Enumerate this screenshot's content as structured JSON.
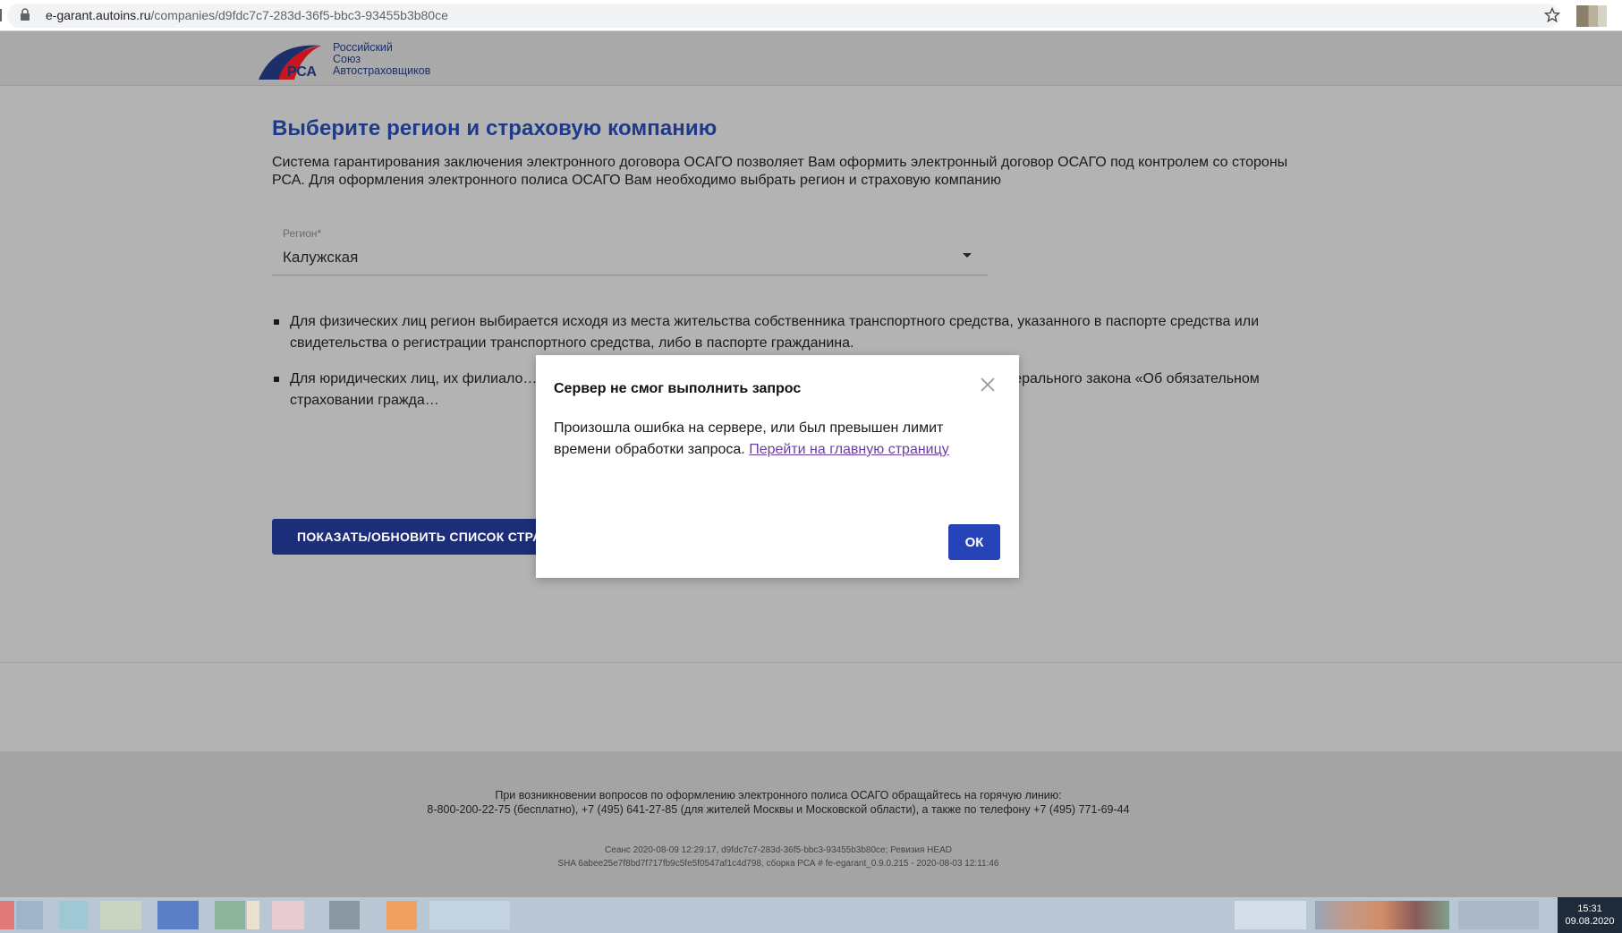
{
  "browser": {
    "url_host": "e-garant.autoins.ru",
    "url_path": "/companies/d9fdc7c7-283d-36f5-bbc3-93455b3b80ce"
  },
  "header": {
    "logo_abbr": "РСА",
    "logo_line1": "Российский",
    "logo_line2": "Союз",
    "logo_line3": "Автостраховщиков"
  },
  "main": {
    "title": "Выберите регион и страховую компанию",
    "intro": "Система гарантирования заключения электронного договора ОСАГО позволяет Вам оформить электронный договор ОСАГО под контролем со стороны РСА. Для оформления электронного полиса ОСАГО Вам необходимо выбрать регион и страховую компанию",
    "region_label": "Регион*",
    "region_value": "Калужская",
    "notes": [
      "Для физических лиц регион выбирается исходя из места жительства собственника транспортного средства, указанного в паспорте средства или свидетельства о регистрации транспортного средства, либо в паспорте гражданина.",
      "Для юридических лиц, их филиало… , его филиала или представительства, указанного в у… 2 статьи 9 Федерального закона «Об обязательном страховании гражда…"
    ],
    "show_button": "ПОКАЗАТЬ/ОБНОВИТЬ СПИСОК СТРАХ"
  },
  "footer": {
    "hotline_1": "При возникновении вопросов по оформлению электронного полиса ОСАГО обращайтесь на горячую линию:",
    "hotline_2": "8-800-200-22-75 (бесплатно), +7 (495) 641-27-85 (для жителей Москвы и Московской области), а также по телефону +7 (495) 771-69-44",
    "session": "Сеанс 2020-08-09 12:29:17, d9fdc7c7-283d-36f5-bbc3-93455b3b80ce; Ревизия HEAD",
    "build": "SHA 6abee25e7f8bd7f717fb9c5fe5f0547af1c4d798, сборка РСА # fe-egarant_0.9.0.215 - 2020-08-03 12:11:46"
  },
  "taskbar": {
    "time": "15:31",
    "date": "09.08.2020"
  },
  "modal": {
    "title": "Сервер не смог выполнить запрос",
    "body": "Произошла ошибка на сервере, или был превышен лимит времени обработки запроса. ",
    "link": "Перейти на главную страницу",
    "ok": "ОК"
  },
  "colors": {
    "brand_blue": "#1e3a8a",
    "button_dark_blue": "#1c2e7a",
    "ok_blue": "#2743b8",
    "link_purple": "#6b3fa0",
    "overlay_gray": "#b3b3b3"
  }
}
